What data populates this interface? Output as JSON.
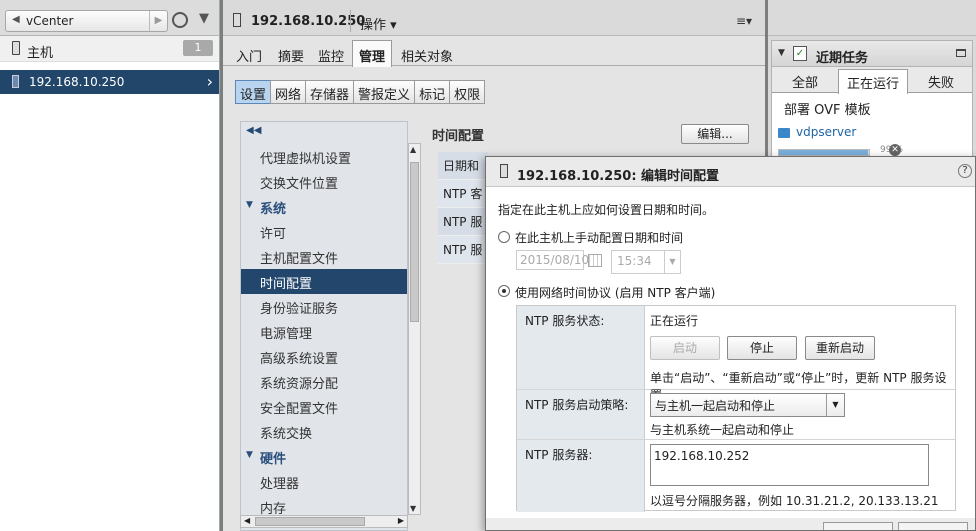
{
  "navigator": {
    "breadcrumb": "vCenter",
    "hosts_label": "主机",
    "hosts_count": "1",
    "selected_host": "192.168.10.250"
  },
  "object": {
    "title": "192.168.10.250",
    "actions_label": "操作 ▾",
    "tabs": [
      "入门",
      "摘要",
      "监控",
      "管理",
      "相关对象"
    ],
    "active_tab": "管理",
    "subtabs": [
      "设置",
      "网络",
      "存储器",
      "警报定义",
      "标记",
      "权限"
    ],
    "active_subtab": "设置"
  },
  "settings_list": {
    "rows": [
      {
        "label": "代理虚拟机设置",
        "kind": "item"
      },
      {
        "label": "交换文件位置",
        "kind": "item"
      },
      {
        "label": "系统",
        "kind": "group"
      },
      {
        "label": "许可",
        "kind": "item"
      },
      {
        "label": "主机配置文件",
        "kind": "item"
      },
      {
        "label": "时间配置",
        "kind": "item",
        "selected": true
      },
      {
        "label": "身份验证服务",
        "kind": "item"
      },
      {
        "label": "电源管理",
        "kind": "item"
      },
      {
        "label": "高级系统设置",
        "kind": "item"
      },
      {
        "label": "系统资源分配",
        "kind": "item"
      },
      {
        "label": "安全配置文件",
        "kind": "item"
      },
      {
        "label": "系统交换",
        "kind": "item"
      },
      {
        "label": "硬件",
        "kind": "group"
      },
      {
        "label": "处理器",
        "kind": "item"
      },
      {
        "label": "内存",
        "kind": "item"
      }
    ]
  },
  "time_config": {
    "title": "时间配置",
    "edit_button": "编辑...",
    "table_rows": [
      "日期和",
      "NTP 客",
      "NTP 服",
      "NTP 服"
    ]
  },
  "recent_tasks": {
    "title": "近期任务",
    "tabs": [
      "全部",
      "正在运行",
      "失败"
    ],
    "active_tab": "正在运行",
    "task1": "部署 OVF 模板",
    "task2": "vdpserver",
    "progress_percent": 99,
    "progress_label": "99 %"
  },
  "dialog": {
    "title": "192.168.10.250: 编辑时间配置",
    "help": "?",
    "intro": "指定在此主机上应如何设置日期和时间。",
    "manual_option": "在此主机上手动配置日期和时间",
    "date_value": "2015/08/10",
    "time_value": "15:34",
    "ntp_option": "使用网络时间协议 (启用 NTP 客户端)",
    "ntp_status_label": "NTP 服务状态:",
    "ntp_status_value": "正在运行",
    "start_button": "启动",
    "stop_button": "停止",
    "restart_button": "重新启动",
    "status_hint": "单击“启动”、“重新启动”或“停止”时，更新 NTP 服务设置。",
    "policy_label": "NTP 服务启动策略:",
    "policy_value": "与主机一起启动和停止",
    "policy_hint": "与主机系统一起启动和停止",
    "servers_label": "NTP 服务器:",
    "servers_value": "192.168.10.252",
    "servers_hint": "以逗号分隔服务器，例如 10.31.21.2, 20.133.13.21"
  }
}
